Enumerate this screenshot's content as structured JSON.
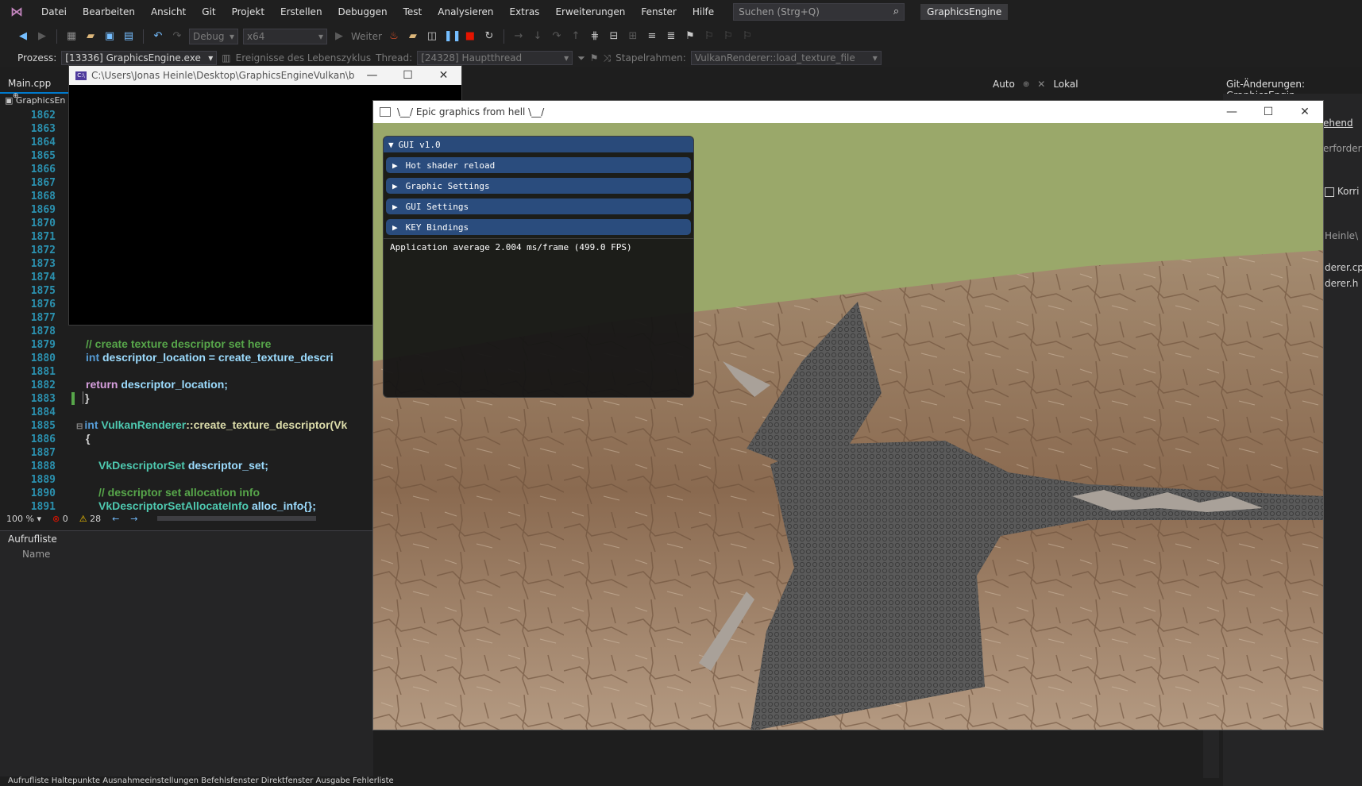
{
  "menubar": {
    "items": [
      "Datei",
      "Bearbeiten",
      "Ansicht",
      "Git",
      "Projekt",
      "Erstellen",
      "Debuggen",
      "Test",
      "Analysieren",
      "Extras",
      "Erweiterungen",
      "Fenster",
      "Hilfe"
    ],
    "search_placeholder": "Suchen (Strg+Q)",
    "solution_name": "GraphicsEngine"
  },
  "toolbar": {
    "config": "Debug",
    "platform": "x64",
    "continue_label": "Weiter"
  },
  "procbar": {
    "process_label": "Prozess:",
    "process_value": "[13336] GraphicsEngine.exe",
    "lifecycle_label": "Ereignisse des Lebenszyklus",
    "thread_label": "Thread:",
    "thread_value": "[24328] Hauptthread",
    "stackframe_label": "Stapelrahmen:",
    "stackframe_value": "VulkanRenderer::load_texture_file"
  },
  "editor": {
    "tab_label": "Main.cpp",
    "nav_label": "GraphicsEn",
    "line_numbers": [
      "1862",
      "1863",
      "1864",
      "1865",
      "1866",
      "1867",
      "1868",
      "1869",
      "1870",
      "1871",
      "1872",
      "1873",
      "1874",
      "1875",
      "1876",
      "1877",
      "1878",
      "1879",
      "1880",
      "1881",
      "1882",
      "1883",
      "1884",
      "1885",
      "1886",
      "1887",
      "1888",
      "1889",
      "1890",
      "1891"
    ],
    "code": {
      "l1879": "// create texture descriptor set here",
      "l1880_kw": "int",
      "l1880_rest": "descriptor_location = create_texture_descri",
      "l1882_kw": "return",
      "l1882_rest": "descriptor_location;",
      "l1883": "}",
      "l1885_kw": "int",
      "l1885_cls": "VulkanRenderer",
      "l1885_fn": "::create_texture_descriptor(Vk",
      "l1886": "{",
      "l1888_type": "VkDescriptorSet",
      "l1888_rest": "descriptor_set;",
      "l1890": "// descriptor set allocation info",
      "l1891_type": "VkDescriptorSetAllocateInfo",
      "l1891_rest": "alloc_info{};"
    },
    "zoom": "100 %",
    "errors": "0",
    "warnings": "28"
  },
  "callstack": {
    "title": "Aufrufliste",
    "col_name": "Name"
  },
  "bottom_tabs": "Aufrufliste   Haltepunkte   Ausnahmeeinstellungen   Befehlsfenster   Direktfenster   Ausgabe   Fehlerliste",
  "watch": {
    "auto_label": "Auto",
    "local_label": "Lokal"
  },
  "git": {
    "title": "Git-Änderungen: GraphicsEngin",
    "link": "ehend",
    "line1": "erforder",
    "checkbox_label": "Korri",
    "line2": "Heinle\\",
    "file1": "derer.cpp",
    "file2": "derer.h"
  },
  "console": {
    "title": "C:\\Users\\Jonas Heinle\\Desktop\\GraphicsEngineVulkan\\build..."
  },
  "game": {
    "title": "\\__/ Epic graphics from hell \\__/"
  },
  "imgui": {
    "title": "GUI v1.0",
    "headers": [
      "Hot shader reload",
      "Graphic Settings",
      "GUI Settings",
      "KEY Bindings"
    ],
    "fps_text": "Application average 2.004 ms/frame (499.0 FPS)"
  },
  "colors": {
    "accent": "#007acc",
    "sky": "#9aa86a",
    "imgui_header": "#2a4c7d"
  }
}
